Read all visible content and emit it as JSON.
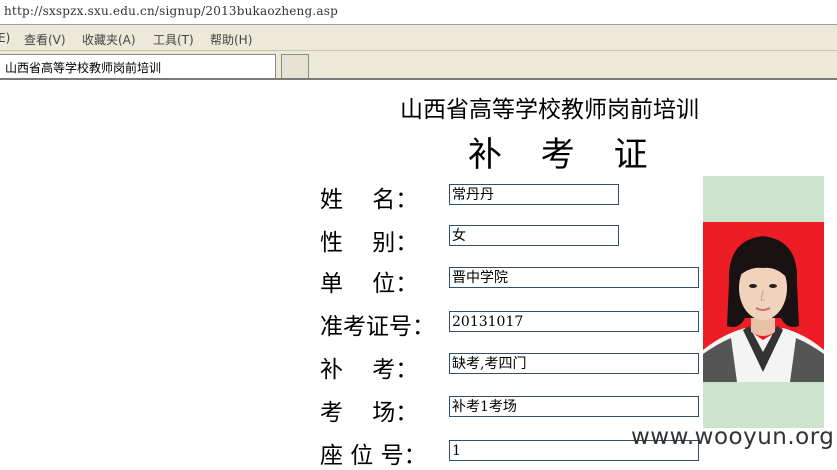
{
  "browser": {
    "address": "http://sxspzx.sxu.edu.cn/signup/2013bukaozheng.asp",
    "menu": [
      {
        "label": "查看(V)"
      },
      {
        "label": "收藏夹(A)"
      },
      {
        "label": "工具(T)"
      },
      {
        "label": "帮助(H)"
      }
    ],
    "menu_fragment": "E)",
    "tab_title": "山西省高等学校教师岗前培训"
  },
  "document": {
    "org_title": "山西省高等学校教师岗前培训",
    "title": "补 考 证",
    "rows": [
      {
        "label": "姓    名：",
        "value": "常丹丹"
      },
      {
        "label": "性    别：",
        "value": "女"
      },
      {
        "label": "单    位：",
        "value": "晋中学院"
      },
      {
        "label": "准考证号：",
        "value": "20131017"
      },
      {
        "label": "补    考：",
        "value": "缺考,考四门"
      },
      {
        "label": "考    场：",
        "value": "补考1考场"
      },
      {
        "label": "座 位 号：",
        "value": "1"
      }
    ]
  },
  "watermark": "www.wooyun.org",
  "colors": {
    "photo_background": "#ee1d25",
    "photo_frame": "#cce4cc",
    "field_border": "#2f4f6f"
  }
}
